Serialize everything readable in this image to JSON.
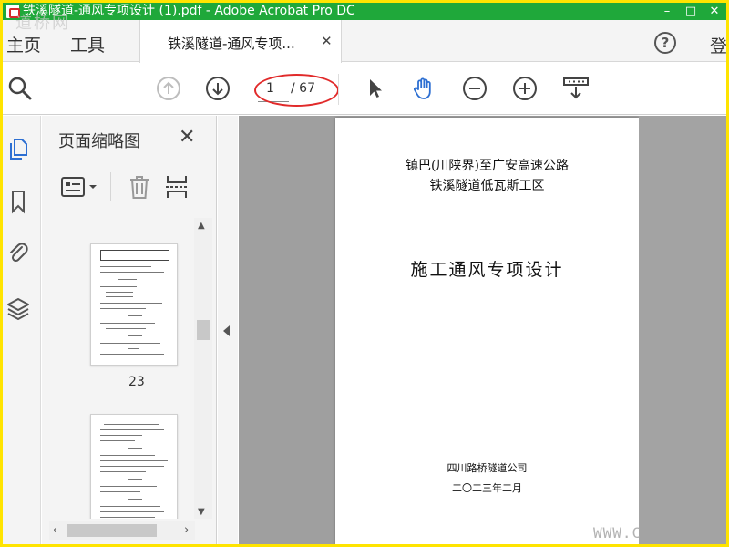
{
  "window": {
    "title": "铁溪隧道-通风专项设计 (1).pdf - Adobe Acrobat Pro DC",
    "minimize_glyph": "–",
    "maximize_glyph": "□",
    "close_glyph": "✕"
  },
  "watermarks": {
    "top": "道桥网",
    "bottom": "WWW.C"
  },
  "tabs": {
    "home": "主页",
    "tools": "工具",
    "document": "铁溪隧道-通风专项...",
    "close_glyph": "✕",
    "help_glyph": "?",
    "login": "登"
  },
  "toolbar": {
    "current_page": "1",
    "total_pages": "/ 67"
  },
  "sidebar_panel": {
    "title": "页面缩略图",
    "close_glyph": "✕",
    "thumbnails": [
      {
        "label": "23"
      },
      {
        "label": ""
      }
    ]
  },
  "document": {
    "title_line_1": "镇巴(川陕界)至广安高速公路",
    "title_line_2": "铁溪隧道低瓦斯工区",
    "main_title": "施工通风专项设计",
    "company": "四川路桥隧道公司",
    "date": "二〇二三年二月"
  },
  "colors": {
    "accent_green": "#1fa83a",
    "border_yellow": "#ffe400",
    "annotation_red": "#e12a2a",
    "icon_blue": "#2d6fd2"
  }
}
